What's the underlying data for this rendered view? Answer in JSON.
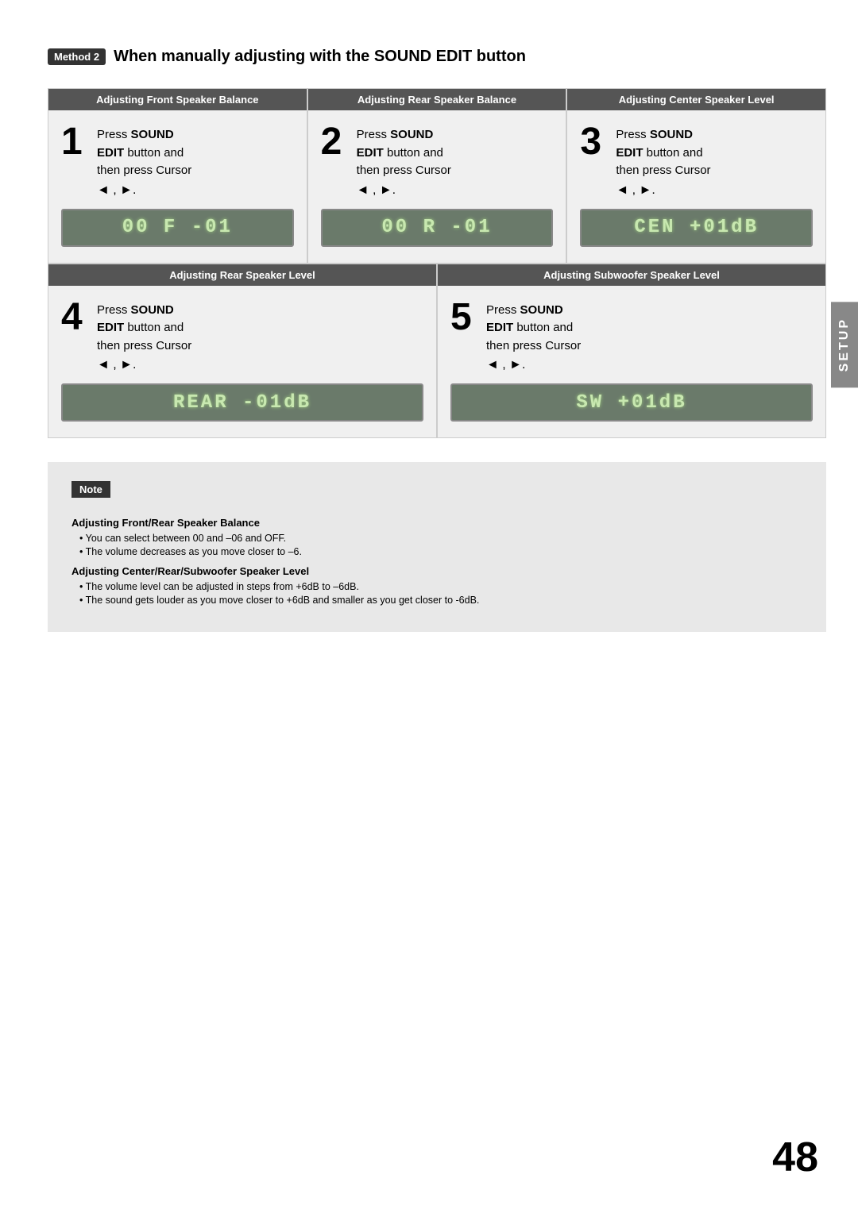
{
  "method": {
    "badge": "Method 2",
    "title": "When manually adjusting with the SOUND EDIT button"
  },
  "sections": [
    {
      "id": "front-balance",
      "header": "Adjusting Front Speaker Balance",
      "step_number": "1",
      "step_text_line1": "Press ",
      "step_text_bold1": "SOUND",
      "step_text_line2": "EDIT",
      "step_text_line3": " button and",
      "step_text_line4": "then press Cursor",
      "lcd": "00 F  -01"
    },
    {
      "id": "rear-balance",
      "header": "Adjusting Rear Speaker Balance",
      "step_number": "2",
      "step_text_line1": "Press ",
      "step_text_bold1": "SOUND",
      "step_text_line2": "EDIT",
      "step_text_line3": " button and",
      "step_text_line4": "then press Cursor",
      "lcd": "00 R  -01"
    },
    {
      "id": "center-level",
      "header": "Adjusting Center Speaker Level",
      "step_number": "3",
      "step_text_line1": "Press ",
      "step_text_bold1": "SOUND",
      "step_text_line2": "EDIT",
      "step_text_line3": " button and",
      "step_text_line4": "then press Cursor",
      "lcd": "CEN  +01dB"
    },
    {
      "id": "rear-level",
      "header": "Adjusting Rear Speaker Level",
      "step_number": "4",
      "step_text_line1": "Press ",
      "step_text_bold1": "SOUND",
      "step_text_line2": "EDIT",
      "step_text_line3": " button and",
      "step_text_line4": "then press Cursor",
      "lcd": "REAR -01dB"
    },
    {
      "id": "subwoofer-level",
      "header": "Adjusting Subwoofer Speaker Level",
      "step_number": "5",
      "step_text_line1": "Press ",
      "step_text_bold1": "SOUND",
      "step_text_line2": "EDIT",
      "step_text_line3": " button and",
      "step_text_line4": "then press Cursor",
      "lcd": "SW   +01dB"
    }
  ],
  "note": {
    "badge": "Note",
    "subtitle1": "Adjusting Front/Rear Speaker Balance",
    "item1_1": "• You can select between 00 and –06 and OFF.",
    "item1_2": "• The volume decreases as you move closer to –6.",
    "subtitle2": "Adjusting Center/Rear/Subwoofer Speaker Level",
    "item2_1": "• The volume level can be adjusted in steps from +6dB to –6dB.",
    "item2_2": "• The sound gets louder as you move closer to +6dB and smaller as you get closer to -6dB."
  },
  "setup_tab": "SETUP",
  "page_number": "48",
  "cursor_arrows": "◄ , ►."
}
